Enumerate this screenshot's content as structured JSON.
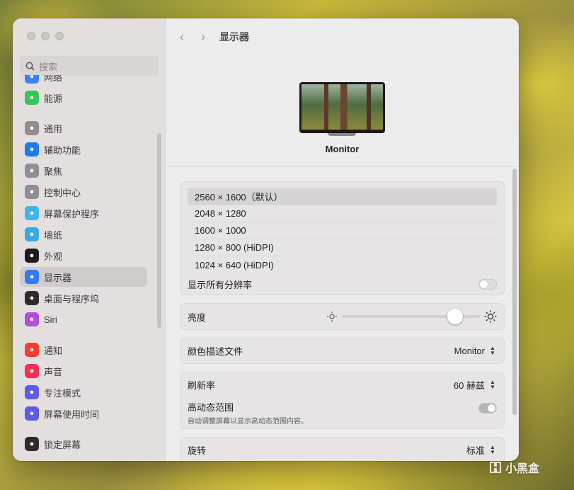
{
  "sidebar": {
    "search_placeholder": "搜索",
    "items": [
      {
        "label": "网络",
        "icon": "globe-icon",
        "color": "#3a82f7"
      },
      {
        "label": "能源",
        "icon": "battery-icon",
        "color": "#34c759"
      },
      {
        "label": "通用",
        "icon": "gear-icon",
        "color": "#8e8e93"
      },
      {
        "label": "辅助功能",
        "icon": "accessibility-icon",
        "color": "#1e7cf2"
      },
      {
        "label": "聚焦",
        "icon": "search-icon",
        "color": "#8e8e93"
      },
      {
        "label": "控制中心",
        "icon": "control-center-icon",
        "color": "#8e8e93"
      },
      {
        "label": "屏幕保护程序",
        "icon": "screensaver-icon",
        "color": "#3fb6e8"
      },
      {
        "label": "墙纸",
        "icon": "flower-icon",
        "color": "#3ba8e6"
      },
      {
        "label": "外观",
        "icon": "appearance-icon",
        "color": "#1c1c1e"
      },
      {
        "label": "显示器",
        "icon": "sun-icon",
        "color": "#2f7cf6"
      },
      {
        "label": "桌面与程序坞",
        "icon": "dock-icon",
        "color": "#2c2c2e"
      },
      {
        "label": "Siri",
        "icon": "siri-icon",
        "color": "#b24fd6"
      },
      {
        "label": "通知",
        "icon": "bell-icon",
        "color": "#ff3b30"
      },
      {
        "label": "声音",
        "icon": "speaker-icon",
        "color": "#ff2d55"
      },
      {
        "label": "专注模式",
        "icon": "moon-icon",
        "color": "#5e5ce6"
      },
      {
        "label": "屏幕使用时间",
        "icon": "hourglass-icon",
        "color": "#5e5ce6"
      },
      {
        "label": "锁定屏幕",
        "icon": "lock-icon",
        "color": "#2c2c2e"
      }
    ]
  },
  "toolbar": {
    "title": "显示器",
    "back": "‹",
    "forward": "›"
  },
  "monitor": {
    "label": "Monitor"
  },
  "resolutions": {
    "options": [
      "2560 × 1600（默认）",
      "2048 × 1280",
      "1600 × 1000",
      "1280 × 800 (HiDPI)",
      "1024 × 640 (HiDPI)"
    ],
    "selected_index": 0,
    "show_all_label": "显示所有分辨率",
    "show_all_on": false
  },
  "brightness": {
    "label": "亮度",
    "value": 0.82
  },
  "color_profile": {
    "label": "颜色描述文件",
    "value": "Monitor"
  },
  "refresh_rate": {
    "label": "刷新率",
    "value": "60 赫兹"
  },
  "hdr": {
    "label": "高动态范围",
    "description": "自动调整屏幕以显示高动态范围内容。",
    "on": true
  },
  "rotation": {
    "label": "旋转",
    "value": "标准"
  },
  "watermark": {
    "text": "小黑盒"
  }
}
